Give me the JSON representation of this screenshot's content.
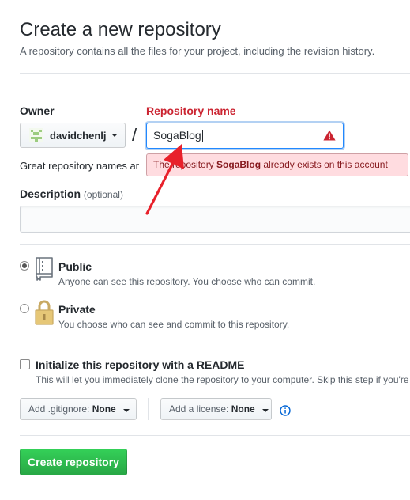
{
  "header": {
    "title": "Create a new repository",
    "subtitle": "A repository contains all the files for your project, including the revision history."
  },
  "owner": {
    "label": "Owner",
    "value": "davidchenlj"
  },
  "repo_name": {
    "label": "Repository name",
    "value": "SogaBlog"
  },
  "helper_text": "Great repository names ar",
  "error": {
    "prefix": "The repository ",
    "name": "SogaBlog",
    "suffix": " already exists on this account"
  },
  "description": {
    "label": "Description",
    "optional": "(optional)",
    "value": ""
  },
  "visibility": {
    "selected": "public",
    "public": {
      "title": "Public",
      "note": "Anyone can see this repository. You choose who can commit."
    },
    "private": {
      "title": "Private",
      "note": "You choose who can see and commit to this repository."
    }
  },
  "init_readme": {
    "checked": false,
    "title": "Initialize this repository with a README",
    "note": "This will let you immediately clone the repository to your computer. Skip this step if you're"
  },
  "gitignore": {
    "label": "Add .gitignore:",
    "value": "None"
  },
  "license": {
    "label": "Add a license:",
    "value": "None"
  },
  "submit_label": "Create repository",
  "colors": {
    "error_red": "#cb2431",
    "annotation_arrow": "#e8212b",
    "create_green": "#28a745",
    "focus_blue": "#2188ff"
  }
}
